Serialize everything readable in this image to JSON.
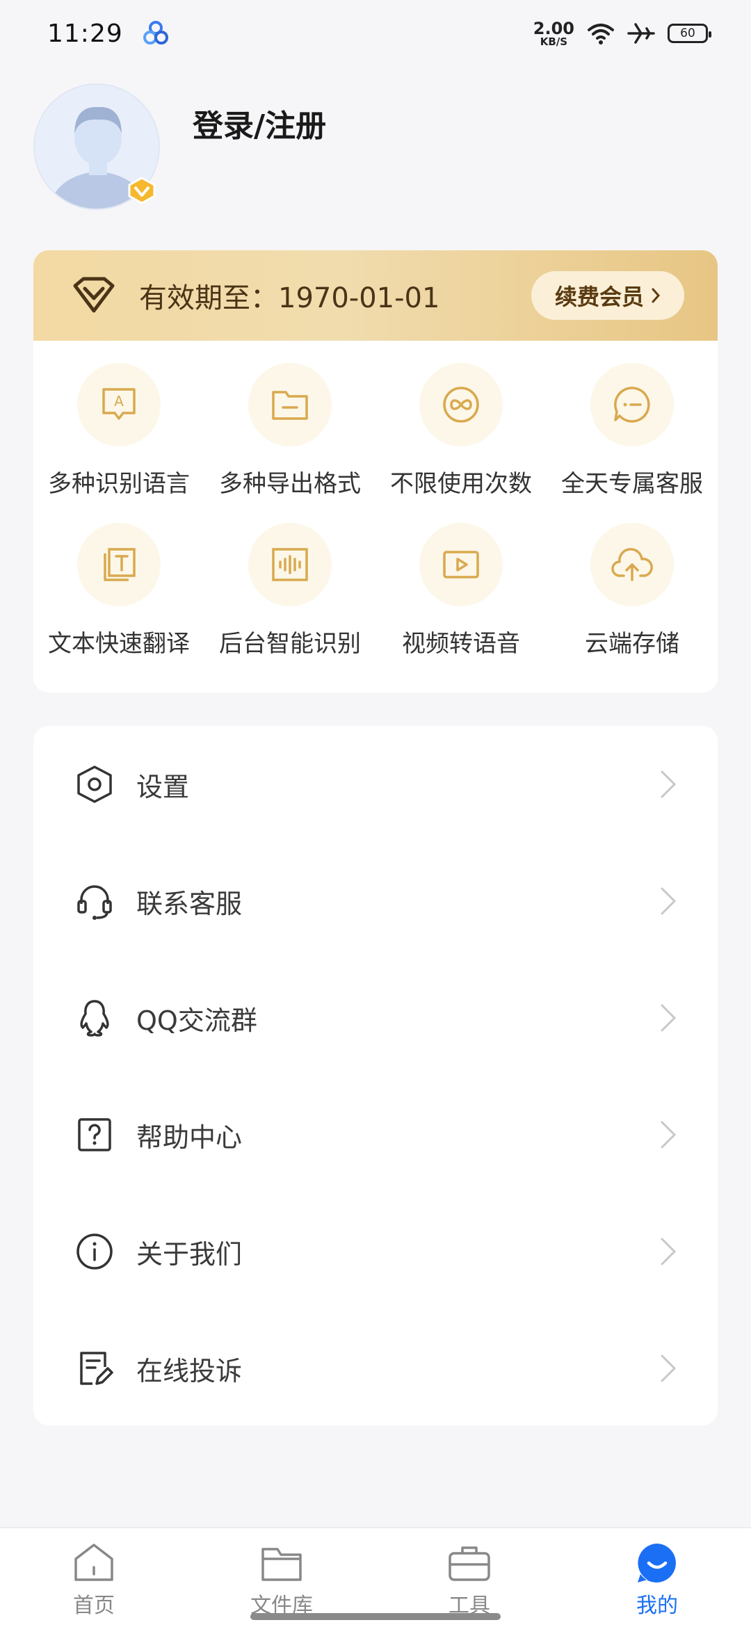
{
  "status_bar": {
    "time": "11:29",
    "net_speed_value": "2.00",
    "net_speed_unit": "KB/S",
    "battery": "60"
  },
  "profile": {
    "login_label": "登录/注册"
  },
  "membership": {
    "expire_text": "有效期至：1970-01-01",
    "renew_label": "续费会员",
    "features": [
      {
        "label": "多种识别语言",
        "icon": "language-icon"
      },
      {
        "label": "多种导出格式",
        "icon": "folder-icon"
      },
      {
        "label": "不限使用次数",
        "icon": "infinity-icon"
      },
      {
        "label": "全天专属客服",
        "icon": "chat-icon"
      },
      {
        "label": "文本快速翻译",
        "icon": "text-translate-icon"
      },
      {
        "label": "后台智能识别",
        "icon": "waveform-icon"
      },
      {
        "label": "视频转语音",
        "icon": "video-icon"
      },
      {
        "label": "云端存储",
        "icon": "cloud-upload-icon"
      }
    ]
  },
  "menu": {
    "items": [
      {
        "label": "设置",
        "icon": "settings-icon"
      },
      {
        "label": "联系客服",
        "icon": "headset-icon"
      },
      {
        "label": "QQ交流群",
        "icon": "qq-icon"
      },
      {
        "label": "帮助中心",
        "icon": "help-icon"
      },
      {
        "label": "关于我们",
        "icon": "info-icon"
      },
      {
        "label": "在线投诉",
        "icon": "complaint-icon"
      }
    ]
  },
  "bottom_nav": {
    "items": [
      {
        "label": "首页",
        "icon": "home-icon"
      },
      {
        "label": "文件库",
        "icon": "folder-icon"
      },
      {
        "label": "工具",
        "icon": "toolbox-icon"
      },
      {
        "label": "我的",
        "icon": "profile-icon",
        "active": true
      }
    ]
  },
  "colors": {
    "gold_icon": "#d9a94f",
    "accent_blue": "#1b6ff5"
  }
}
